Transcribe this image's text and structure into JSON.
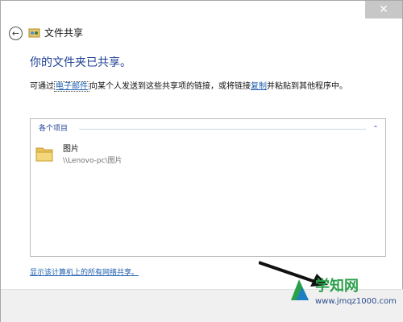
{
  "window": {
    "title": "文件共享",
    "close_icon": "close-icon"
  },
  "content": {
    "heading": "你的文件夹已共享。",
    "desc_prefix": "可通过",
    "email_link": "电子邮件",
    "desc_middle": "向某个人发送到这些共享项的链接，或将链接",
    "copy_link": "复制",
    "desc_suffix": "并粘贴到其他程序中。"
  },
  "list": {
    "group_label": "各个项目",
    "items": [
      {
        "name": "图片",
        "path": "\\\\Lenovo-pc\\图片",
        "icon": "folder-icon"
      }
    ]
  },
  "footer": {
    "network_link": "显示该计算机上的所有网络共享。"
  },
  "watermark": {
    "brand": "学知网",
    "url": "www.jmqz1000.com"
  },
  "colors": {
    "heading": "#1e3f94",
    "link": "#1f5fb0",
    "watermark_green": "#2aa04a"
  }
}
